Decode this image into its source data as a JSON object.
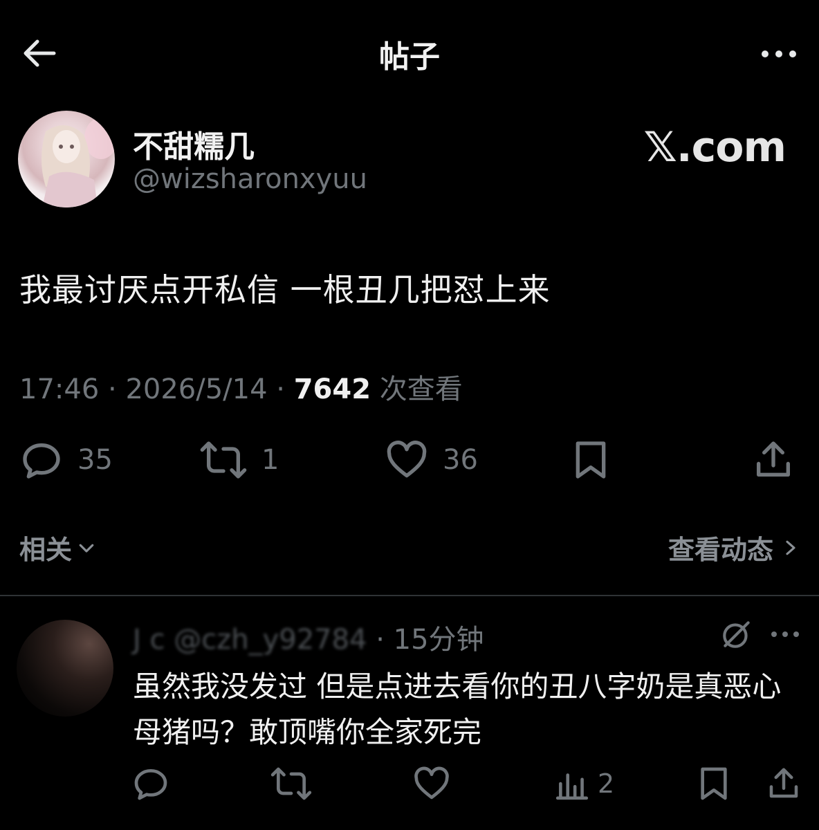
{
  "header": {
    "title": "帖子"
  },
  "post": {
    "author": {
      "display_name": "不甜糯几",
      "handle": "@wizsharonxyuu"
    },
    "watermark": "𝕏.com",
    "text": "我最讨厌点开私信 一根丑几把怼上来",
    "time": "17:46",
    "separator": "·",
    "date": "2026/5/14",
    "views": "7642",
    "views_label": "次查看",
    "stats": {
      "replies": "35",
      "reposts": "1",
      "likes": "36"
    }
  },
  "related": {
    "label": "相关",
    "activity_label": "查看动态"
  },
  "reply": {
    "name_partial": "J c",
    "handle_partial": "@czh_y92784",
    "separator": "·",
    "time": "15分钟",
    "text": "虽然我没发过 但是点进去看你的丑八字奶是真恶心 母猪吗？敢顶嘴你全家死完",
    "views": "2"
  },
  "icons": {
    "back": "arrow-left-icon",
    "more": "more-horizontal-icon",
    "reply": "reply-icon",
    "repost": "repost-icon",
    "like": "heart-icon",
    "bookmark": "bookmark-icon",
    "share": "share-icon",
    "analytics": "analytics-icon",
    "grok": "grok-icon",
    "chevron_down": "chevron-down-icon",
    "chevron_right": "chevron-right-icon"
  },
  "colors": {
    "background": "#000000",
    "text": "#e7e9ea",
    "muted": "#71767b",
    "divider": "#2f3336"
  }
}
